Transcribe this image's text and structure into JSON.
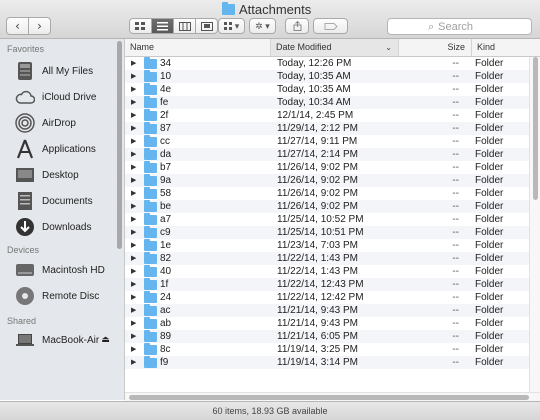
{
  "window": {
    "title": "Attachments"
  },
  "toolbar": {
    "back_symbol": "‹",
    "forward_symbol": "›",
    "search_placeholder": "Search",
    "search_symbol": "⌕",
    "arrange_symbol": "▾",
    "action_symbol": "✲ ▾"
  },
  "sidebar": {
    "sections": [
      {
        "heading": "Favorites",
        "items": [
          {
            "label": "All My Files",
            "icon": "all-my-files-icon"
          },
          {
            "label": "iCloud Drive",
            "icon": "cloud-icon"
          },
          {
            "label": "AirDrop",
            "icon": "airdrop-icon"
          },
          {
            "label": "Applications",
            "icon": "applications-icon"
          },
          {
            "label": "Desktop",
            "icon": "desktop-icon"
          },
          {
            "label": "Documents",
            "icon": "documents-icon"
          },
          {
            "label": "Downloads",
            "icon": "downloads-icon"
          }
        ]
      },
      {
        "heading": "Devices",
        "items": [
          {
            "label": "Macintosh HD",
            "icon": "hard-drive-icon"
          },
          {
            "label": "Remote Disc",
            "icon": "disc-icon"
          }
        ]
      },
      {
        "heading": "Shared",
        "items": [
          {
            "label": "MacBook-Air",
            "icon": "laptop-icon",
            "eject": "⏏"
          }
        ]
      }
    ]
  },
  "columns": {
    "name": "Name",
    "date": "Date Modified",
    "size": "Size",
    "kind": "Kind",
    "sort_symbol": "⌄"
  },
  "rows": [
    {
      "name": "34",
      "date": "Today, 12:26 PM",
      "size": "--",
      "kind": "Folder"
    },
    {
      "name": "10",
      "date": "Today, 10:35 AM",
      "size": "--",
      "kind": "Folder"
    },
    {
      "name": "4e",
      "date": "Today, 10:35 AM",
      "size": "--",
      "kind": "Folder"
    },
    {
      "name": "fe",
      "date": "Today, 10:34 AM",
      "size": "--",
      "kind": "Folder"
    },
    {
      "name": "2f",
      "date": "12/1/14, 2:45 PM",
      "size": "--",
      "kind": "Folder"
    },
    {
      "name": "87",
      "date": "11/29/14, 2:12 PM",
      "size": "--",
      "kind": "Folder"
    },
    {
      "name": "cc",
      "date": "11/27/14, 9:11 PM",
      "size": "--",
      "kind": "Folder"
    },
    {
      "name": "da",
      "date": "11/27/14, 2:14 PM",
      "size": "--",
      "kind": "Folder"
    },
    {
      "name": "b7",
      "date": "11/26/14, 9:02 PM",
      "size": "--",
      "kind": "Folder"
    },
    {
      "name": "9a",
      "date": "11/26/14, 9:02 PM",
      "size": "--",
      "kind": "Folder"
    },
    {
      "name": "58",
      "date": "11/26/14, 9:02 PM",
      "size": "--",
      "kind": "Folder"
    },
    {
      "name": "be",
      "date": "11/26/14, 9:02 PM",
      "size": "--",
      "kind": "Folder"
    },
    {
      "name": "a7",
      "date": "11/25/14, 10:52 PM",
      "size": "--",
      "kind": "Folder"
    },
    {
      "name": "c9",
      "date": "11/25/14, 10:51 PM",
      "size": "--",
      "kind": "Folder"
    },
    {
      "name": "1e",
      "date": "11/23/14, 7:03 PM",
      "size": "--",
      "kind": "Folder"
    },
    {
      "name": "82",
      "date": "11/22/14, 1:43 PM",
      "size": "--",
      "kind": "Folder"
    },
    {
      "name": "40",
      "date": "11/22/14, 1:43 PM",
      "size": "--",
      "kind": "Folder"
    },
    {
      "name": "1f",
      "date": "11/22/14, 12:43 PM",
      "size": "--",
      "kind": "Folder"
    },
    {
      "name": "24",
      "date": "11/22/14, 12:42 PM",
      "size": "--",
      "kind": "Folder"
    },
    {
      "name": "ac",
      "date": "11/21/14, 9:43 PM",
      "size": "--",
      "kind": "Folder"
    },
    {
      "name": "ab",
      "date": "11/21/14, 9:43 PM",
      "size": "--",
      "kind": "Folder"
    },
    {
      "name": "89",
      "date": "11/21/14, 6:05 PM",
      "size": "--",
      "kind": "Folder"
    },
    {
      "name": "8c",
      "date": "11/19/14, 3:25 PM",
      "size": "--",
      "kind": "Folder"
    },
    {
      "name": "f9",
      "date": "11/19/14, 3:14 PM",
      "size": "--",
      "kind": "Folder"
    }
  ],
  "status": {
    "text": "60 items, 18.93 GB available"
  },
  "colors": {
    "folder": "#65b5ee",
    "sidebar_bg": "#e4e7eb",
    "alt_row": "#f3f5f8"
  }
}
